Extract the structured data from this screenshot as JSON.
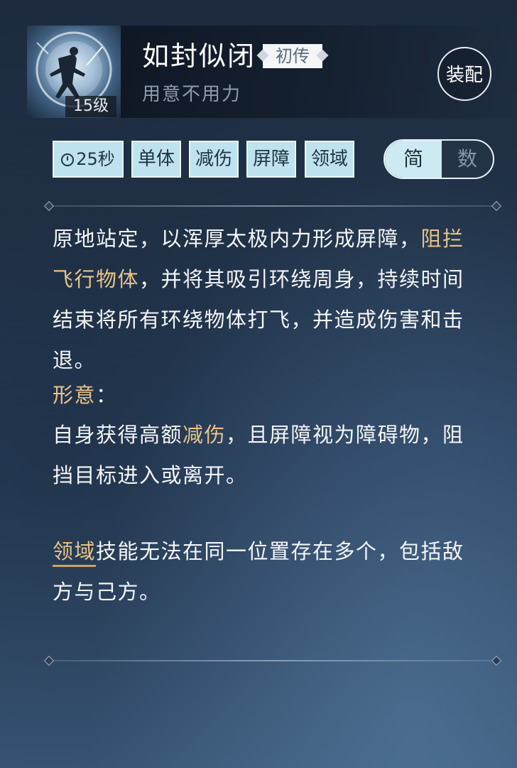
{
  "skill": {
    "name": "如封似闭",
    "rank": "初传",
    "subtitle": "用意不用力",
    "level": "15级",
    "equip_label": "装配"
  },
  "tags": {
    "duration": "25秒",
    "items": [
      "单体",
      "减伤",
      "屏障",
      "领域"
    ]
  },
  "toggle": {
    "simple_label": "简",
    "numeric_label": "数",
    "selected": "简"
  },
  "description": {
    "main_part1": "原地站定，以浑厚太极内力形成屏障，",
    "main_highlight": "阻拦飞行物体",
    "main_part2": "，并将其吸引环绕周身，持续时间结束将所有环绕物体打飞，并造成伤害和击退。",
    "form_label": "形意",
    "form_colon": "：",
    "form_part1": "自身获得高额",
    "form_highlight": "减伤",
    "form_part2": "，且屏障视为障碍物，阻挡目标进入或离开。",
    "domain_link": "领域",
    "domain_text": "技能无法在同一位置存在多个，包括敌方与己方。"
  },
  "colors": {
    "highlight": "#e8c38a",
    "tag_bg": "#bfe3ee",
    "text": "#f4f6f8"
  },
  "icons": {
    "skill": "taiji-master-icon",
    "timer": "clock-icon"
  }
}
